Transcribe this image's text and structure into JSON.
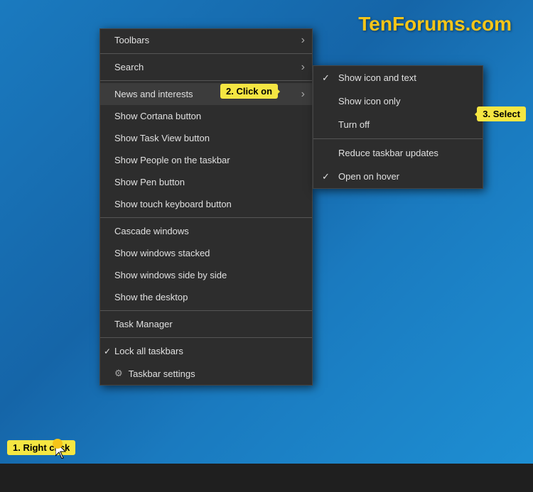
{
  "watermark": {
    "text": "TenForums.com"
  },
  "contextMenu": {
    "items": [
      {
        "id": "toolbars",
        "label": "Toolbars",
        "hasArrow": true,
        "hasDividerAfter": false,
        "hasCheck": false,
        "hasGear": false
      },
      {
        "id": "search",
        "label": "Search",
        "hasArrow": true,
        "hasDividerAfter": true,
        "hasCheck": false,
        "hasGear": false
      },
      {
        "id": "news-interests",
        "label": "News and interests",
        "hasArrow": true,
        "hasDividerAfter": false,
        "hasCheck": false,
        "hasGear": false,
        "highlighted": true
      },
      {
        "id": "show-cortana",
        "label": "Show Cortana button",
        "hasArrow": false,
        "hasDividerAfter": false,
        "hasCheck": false,
        "hasGear": false
      },
      {
        "id": "show-taskview",
        "label": "Show Task View button",
        "hasArrow": false,
        "hasDividerAfter": false,
        "hasCheck": false,
        "hasGear": false
      },
      {
        "id": "show-people",
        "label": "Show People on the taskbar",
        "hasArrow": false,
        "hasDividerAfter": false,
        "hasCheck": false,
        "hasGear": false
      },
      {
        "id": "show-pen",
        "label": "Show Pen button",
        "hasArrow": false,
        "hasDividerAfter": false,
        "hasCheck": false,
        "hasGear": false
      },
      {
        "id": "show-touch-keyboard",
        "label": "Show touch keyboard button",
        "hasArrow": false,
        "hasDividerAfter": true,
        "hasCheck": false,
        "hasGear": false
      },
      {
        "id": "cascade-windows",
        "label": "Cascade windows",
        "hasArrow": false,
        "hasDividerAfter": false,
        "hasCheck": false,
        "hasGear": false
      },
      {
        "id": "show-windows-stacked",
        "label": "Show windows stacked",
        "hasArrow": false,
        "hasDividerAfter": false,
        "hasCheck": false,
        "hasGear": false
      },
      {
        "id": "show-windows-side",
        "label": "Show windows side by side",
        "hasArrow": false,
        "hasDividerAfter": false,
        "hasCheck": false,
        "hasGear": false
      },
      {
        "id": "show-desktop",
        "label": "Show the desktop",
        "hasArrow": false,
        "hasDividerAfter": true,
        "hasCheck": false,
        "hasGear": false
      },
      {
        "id": "task-manager",
        "label": "Task Manager",
        "hasArrow": false,
        "hasDividerAfter": true,
        "hasCheck": false,
        "hasGear": false
      },
      {
        "id": "lock-taskbars",
        "label": "Lock all taskbars",
        "hasArrow": false,
        "hasDividerAfter": false,
        "hasCheck": true,
        "hasGear": false
      },
      {
        "id": "taskbar-settings",
        "label": "Taskbar settings",
        "hasArrow": false,
        "hasDividerAfter": false,
        "hasCheck": false,
        "hasGear": true
      }
    ]
  },
  "submenu": {
    "items": [
      {
        "id": "show-icon-text",
        "label": "Show icon and text",
        "hasCheck": true
      },
      {
        "id": "show-icon-only",
        "label": "Show icon only",
        "hasCheck": false
      },
      {
        "id": "turn-off",
        "label": "Turn off",
        "hasCheck": false
      },
      {
        "id": "divider",
        "label": "",
        "isDivider": true
      },
      {
        "id": "reduce-updates",
        "label": "Reduce taskbar updates",
        "hasCheck": false
      },
      {
        "id": "open-hover",
        "label": "Open on hover",
        "hasCheck": true
      }
    ]
  },
  "tooltips": {
    "click": "2. Click on",
    "select": "3. Select",
    "rightclick": "1. Right click"
  }
}
